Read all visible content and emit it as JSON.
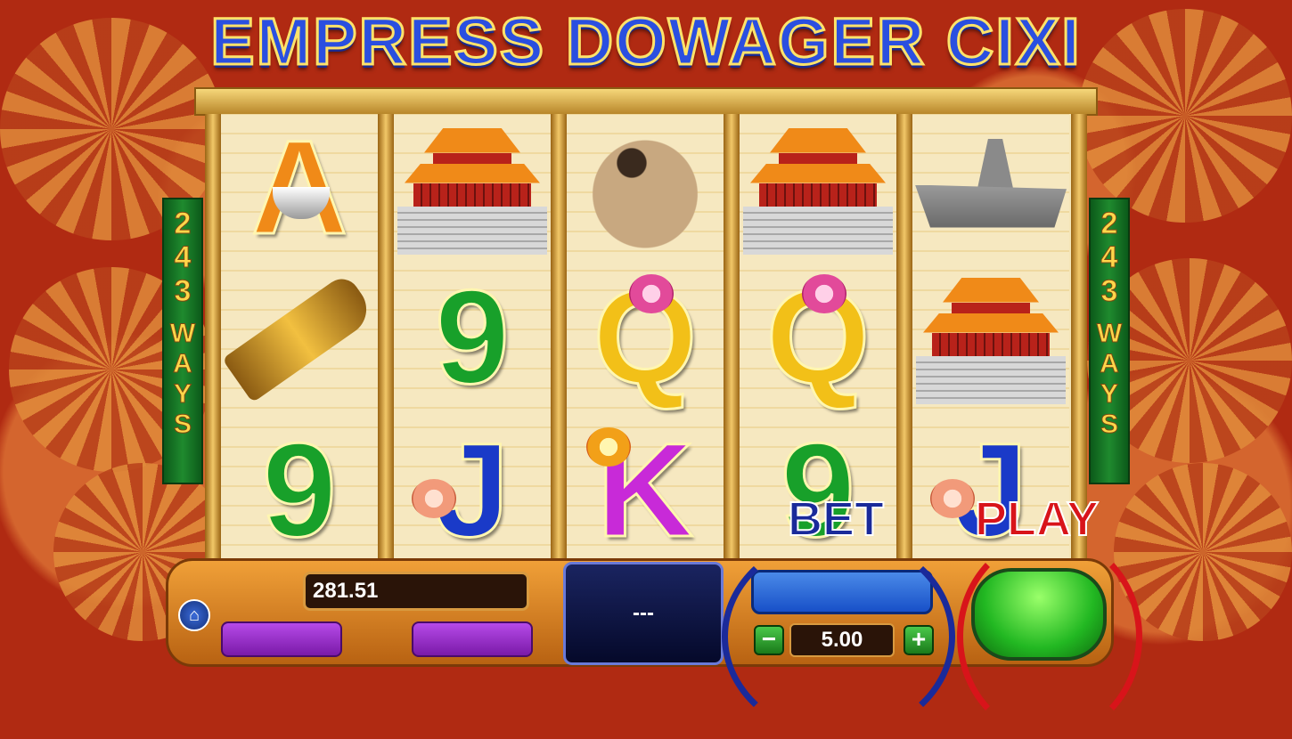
{
  "game": {
    "title": "EMPRESS DOWAGER CIXI",
    "ways_left": [
      "2",
      "4",
      "3",
      "W",
      "A",
      "Y",
      "S"
    ],
    "ways_right": [
      "2",
      "4",
      "3",
      "W",
      "A",
      "Y",
      "S"
    ]
  },
  "reels": [
    [
      "A",
      "pistol",
      "9"
    ],
    [
      "palace",
      "9",
      "J"
    ],
    [
      "pekingese-dog",
      "Q",
      "K"
    ],
    [
      "palace",
      "Q",
      "9"
    ],
    [
      "battleship",
      "palace",
      "J"
    ]
  ],
  "console": {
    "balance": "281.51",
    "lines_display": "---",
    "bet_label": "BET",
    "bet_value": "5.00",
    "minus_label": "−",
    "plus_label": "+",
    "play_label": "PLAY",
    "home_icon": "⌂"
  },
  "colors": {
    "title_blue": "#2a4fe0",
    "bet_label": "#1a2a9a",
    "play_label": "#d8141a",
    "play_button": "#22b822"
  }
}
